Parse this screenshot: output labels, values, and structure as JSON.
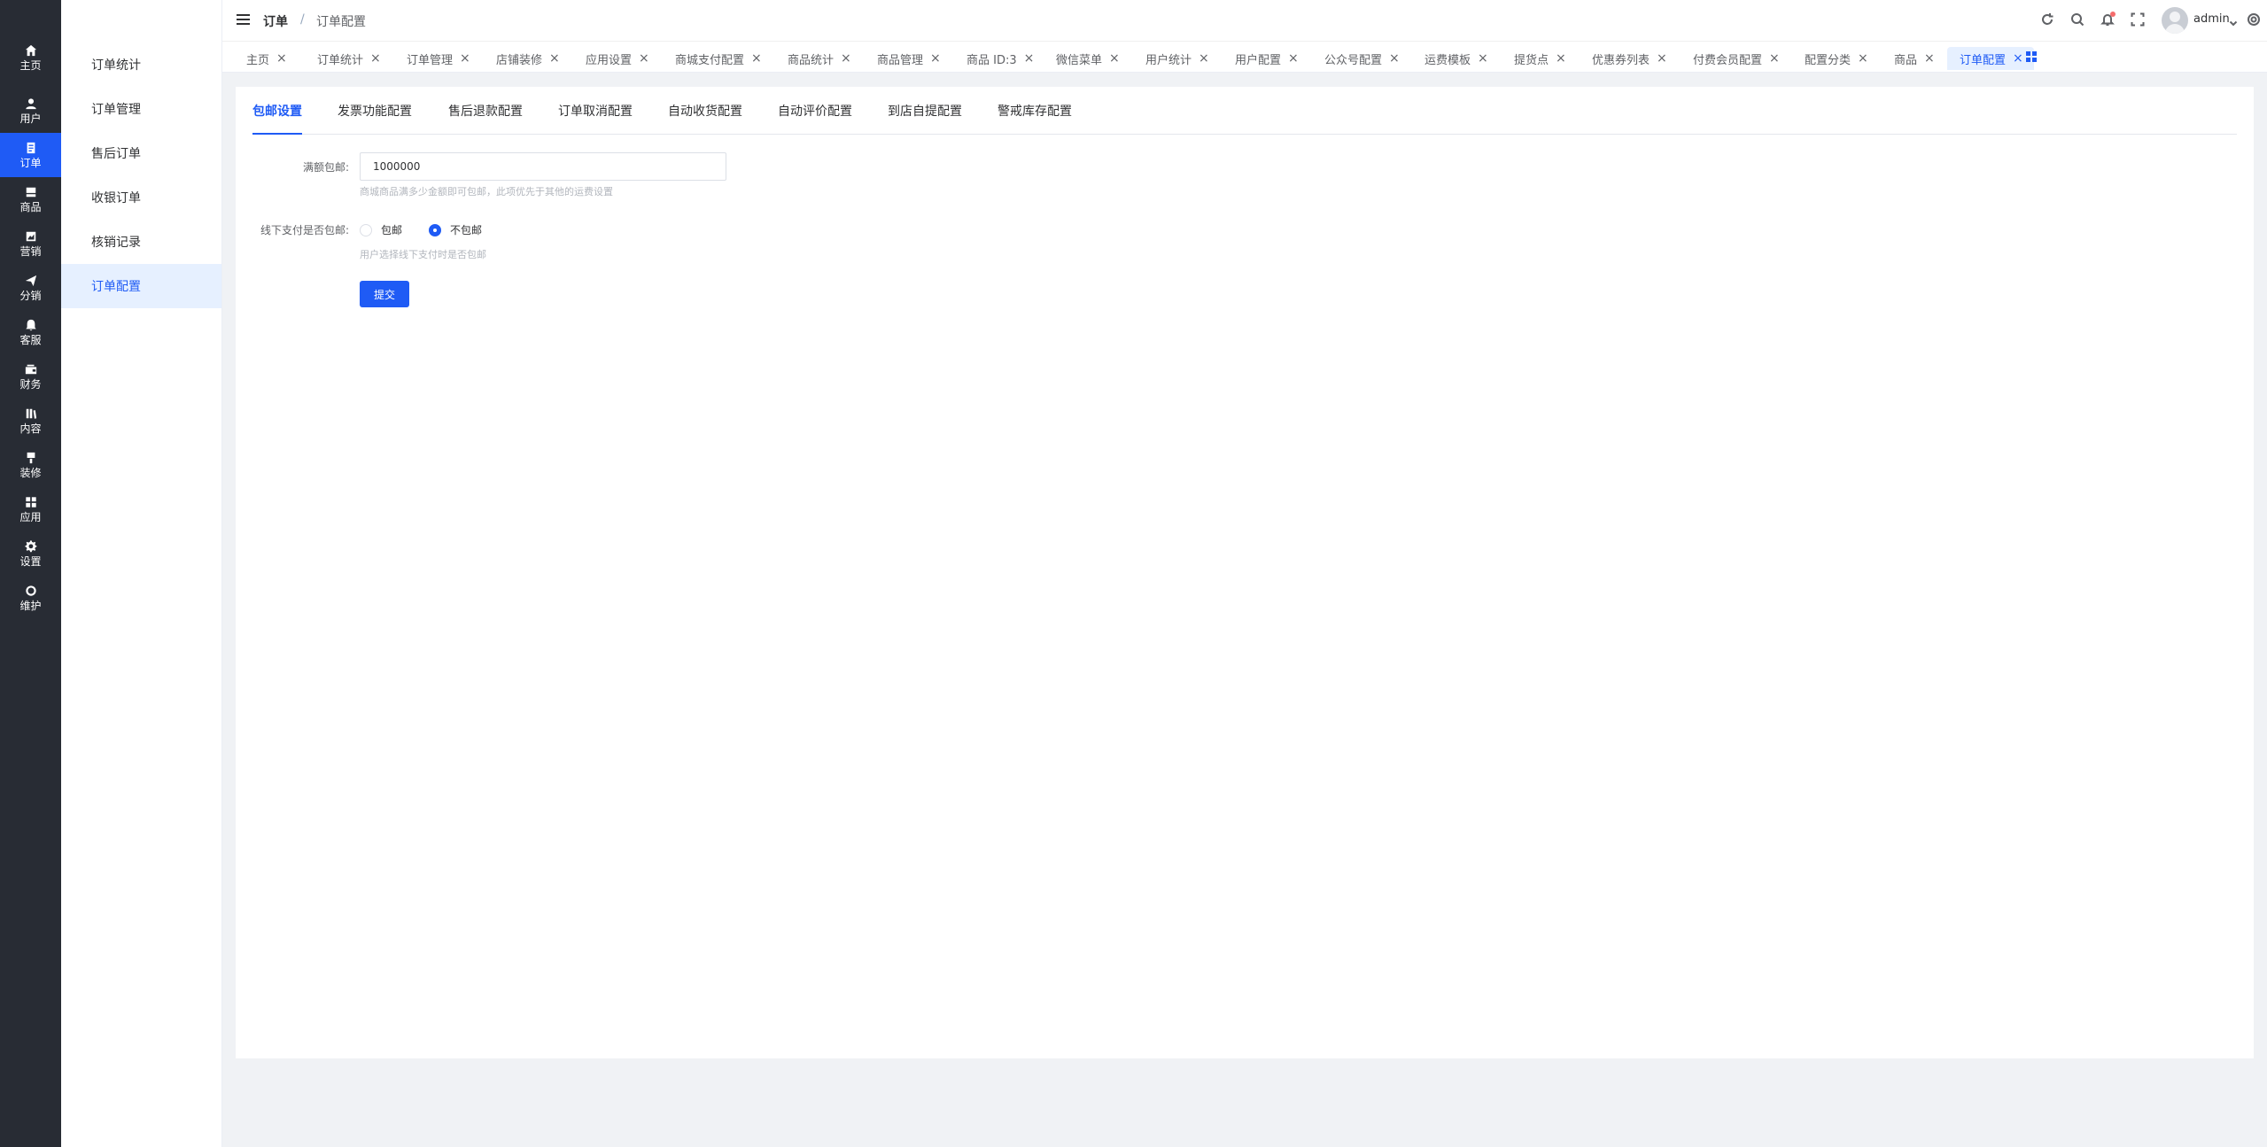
{
  "rail": {
    "items": [
      {
        "label": "主页",
        "icon": "home-icon"
      },
      {
        "label": "用户",
        "icon": "user-icon"
      },
      {
        "label": "订单",
        "icon": "order-icon",
        "active": true
      },
      {
        "label": "商品",
        "icon": "goods-icon"
      },
      {
        "label": "营销",
        "icon": "marketing-icon"
      },
      {
        "label": "分销",
        "icon": "distribution-icon"
      },
      {
        "label": "客服",
        "icon": "service-icon"
      },
      {
        "label": "财务",
        "icon": "finance-icon"
      },
      {
        "label": "内容",
        "icon": "content-icon"
      },
      {
        "label": "装修",
        "icon": "decoration-icon"
      },
      {
        "label": "应用",
        "icon": "apps-icon"
      },
      {
        "label": "设置",
        "icon": "settings-icon"
      },
      {
        "label": "维护",
        "icon": "maintenance-icon"
      }
    ]
  },
  "submenu": {
    "items": [
      {
        "label": "订单统计"
      },
      {
        "label": "订单管理"
      },
      {
        "label": "售后订单"
      },
      {
        "label": "收银订单"
      },
      {
        "label": "核销记录"
      },
      {
        "label": "订单配置",
        "active": true
      }
    ]
  },
  "header": {
    "breadcrumb": [
      "订单",
      "订单配置"
    ],
    "separator": "/",
    "username": "admin",
    "icons": [
      "refresh-icon",
      "search-icon",
      "bell-icon",
      "fullscreen-icon",
      "settings-icon"
    ]
  },
  "tags": [
    {
      "label": "主页"
    },
    {
      "label": "订单统计"
    },
    {
      "label": "订单管理"
    },
    {
      "label": "店铺装修"
    },
    {
      "label": "应用设置"
    },
    {
      "label": "商城支付配置"
    },
    {
      "label": "商品统计"
    },
    {
      "label": "商品管理"
    },
    {
      "label": "商品 ID:3"
    },
    {
      "label": "微信菜单"
    },
    {
      "label": "用户统计"
    },
    {
      "label": "用户配置"
    },
    {
      "label": "公众号配置"
    },
    {
      "label": "运费模板"
    },
    {
      "label": "提货点"
    },
    {
      "label": "优惠券列表"
    },
    {
      "label": "付费会员配置"
    },
    {
      "label": "配置分类"
    },
    {
      "label": "商品"
    },
    {
      "label": "订单配置",
      "active": true
    }
  ],
  "tabs": [
    {
      "label": "包邮设置",
      "active": true
    },
    {
      "label": "发票功能配置"
    },
    {
      "label": "售后退款配置"
    },
    {
      "label": "订单取消配置"
    },
    {
      "label": "自动收货配置"
    },
    {
      "label": "自动评价配置"
    },
    {
      "label": "到店自提配置"
    },
    {
      "label": "警戒库存配置"
    }
  ],
  "form": {
    "free_shipping_label": "满额包邮:",
    "free_shipping_value": "1000000",
    "free_shipping_hint": "商城商品满多少金额即可包邮，此项优先于其他的运费设置",
    "offline_label": "线下支付是否包邮:",
    "offline_options": [
      "包邮",
      "不包邮"
    ],
    "offline_selected": "不包邮",
    "offline_hint": "用户选择线下支付时是否包邮",
    "submit_label": "提交"
  },
  "colors": {
    "primary": "#1f5bf5",
    "rail_bg": "#282c34",
    "page_bg": "#f0f2f5"
  }
}
